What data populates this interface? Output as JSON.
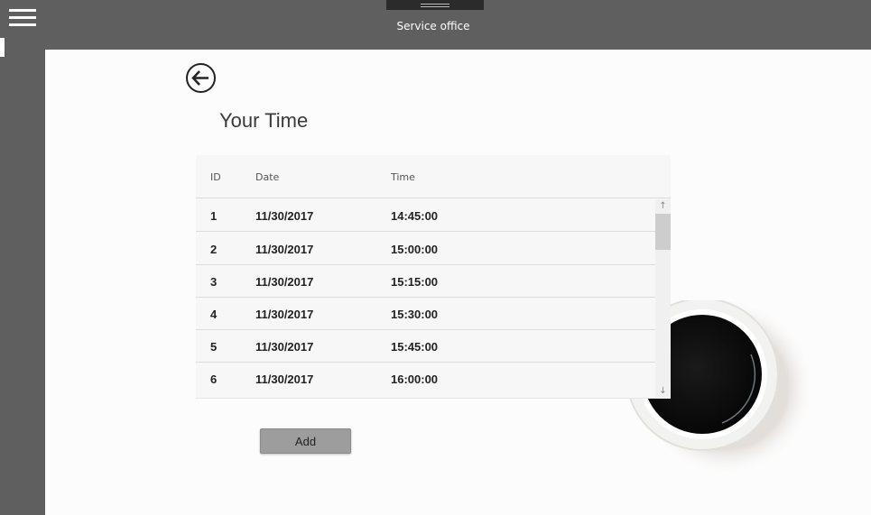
{
  "app": {
    "title": "Service office"
  },
  "page": {
    "title": "Your Time"
  },
  "table": {
    "headers": {
      "id": "ID",
      "date": "Date",
      "time": "Time"
    },
    "rows": [
      {
        "id": "1",
        "date": "11/30/2017",
        "time": "14:45:00"
      },
      {
        "id": "2",
        "date": "11/30/2017",
        "time": "15:00:00"
      },
      {
        "id": "3",
        "date": "11/30/2017",
        "time": "15:15:00"
      },
      {
        "id": "4",
        "date": "11/30/2017",
        "time": "15:30:00"
      },
      {
        "id": "5",
        "date": "11/30/2017",
        "time": "15:45:00"
      },
      {
        "id": "6",
        "date": "11/30/2017",
        "time": "16:00:00"
      }
    ]
  },
  "actions": {
    "add_label": "Add"
  },
  "icons": {
    "menu": "hamburger-menu-icon",
    "back": "back-arrow-icon",
    "scroll_up": "arrow-up-icon",
    "scroll_down": "arrow-down-icon"
  },
  "colors": {
    "chrome": "#5f5f5f",
    "content_bg": "#fcfcfc",
    "button": "#9d9d9d"
  }
}
